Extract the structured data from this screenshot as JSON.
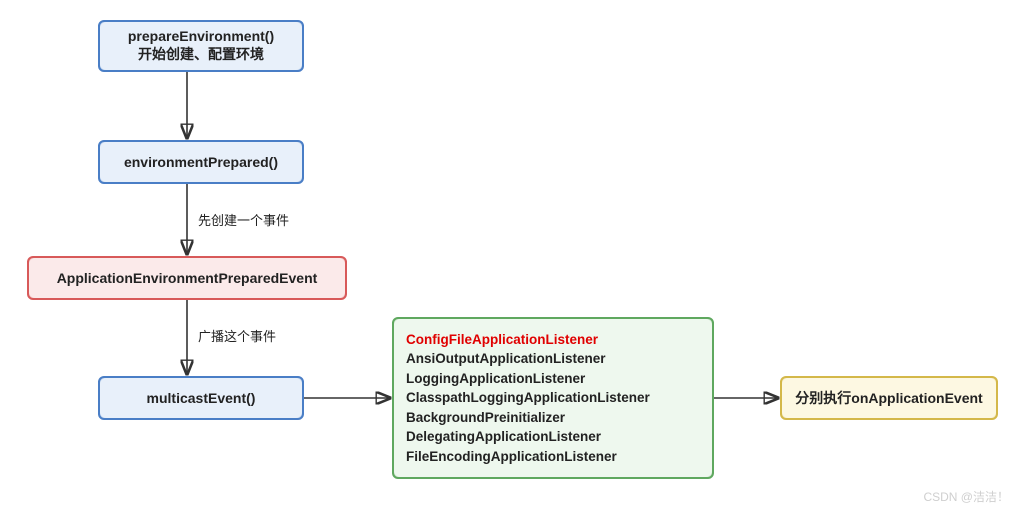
{
  "boxes": {
    "prepareEnv": {
      "line1": "prepareEnvironment()",
      "line2": "开始创建、配置环境"
    },
    "envPrepared": {
      "line1": "environmentPrepared()"
    },
    "eventBox": {
      "line1": "ApplicationEnvironmentPreparedEvent"
    },
    "multicast": {
      "line1": "multicastEvent()"
    },
    "listeners": {
      "item1": "ConfigFileApplicationListener",
      "item2": "AnsiOutputApplicationListener",
      "item3": "LoggingApplicationListener",
      "item4": "ClasspathLoggingApplicationListener",
      "item5": "BackgroundPreinitializer",
      "item6": "DelegatingApplicationListener",
      "item7": "FileEncodingApplicationListener"
    },
    "onEvent": {
      "line1": "分别执行onApplicationEvent"
    }
  },
  "edgeLabels": {
    "createEvent": "先创建一个事件",
    "broadcastEvent": "广播这个事件"
  },
  "watermark": "CSDN @洁洁！",
  "chart_data": {
    "type": "flowchart",
    "nodes": [
      {
        "id": "prepareEnv",
        "label": "prepareEnvironment()\n开始创建、配置环境",
        "style": "blue"
      },
      {
        "id": "envPrepared",
        "label": "environmentPrepared()",
        "style": "blue"
      },
      {
        "id": "eventBox",
        "label": "ApplicationEnvironmentPreparedEvent",
        "style": "red"
      },
      {
        "id": "multicast",
        "label": "multicastEvent()",
        "style": "blue"
      },
      {
        "id": "listeners",
        "label": "ConfigFileApplicationListener\nAnsiOutputApplicationListener\nLoggingApplicationListener\nClasspathLoggingApplicationListener\nBackgroundPreinitializer\nDelegatingApplicationListener\nFileEncodingApplicationListener",
        "style": "green"
      },
      {
        "id": "onEvent",
        "label": "分别执行onApplicationEvent",
        "style": "yellow"
      }
    ],
    "edges": [
      {
        "from": "prepareEnv",
        "to": "envPrepared",
        "label": ""
      },
      {
        "from": "envPrepared",
        "to": "eventBox",
        "label": "先创建一个事件"
      },
      {
        "from": "eventBox",
        "to": "multicast",
        "label": "广播这个事件"
      },
      {
        "from": "multicast",
        "to": "listeners",
        "label": ""
      },
      {
        "from": "listeners",
        "to": "onEvent",
        "label": ""
      }
    ]
  }
}
